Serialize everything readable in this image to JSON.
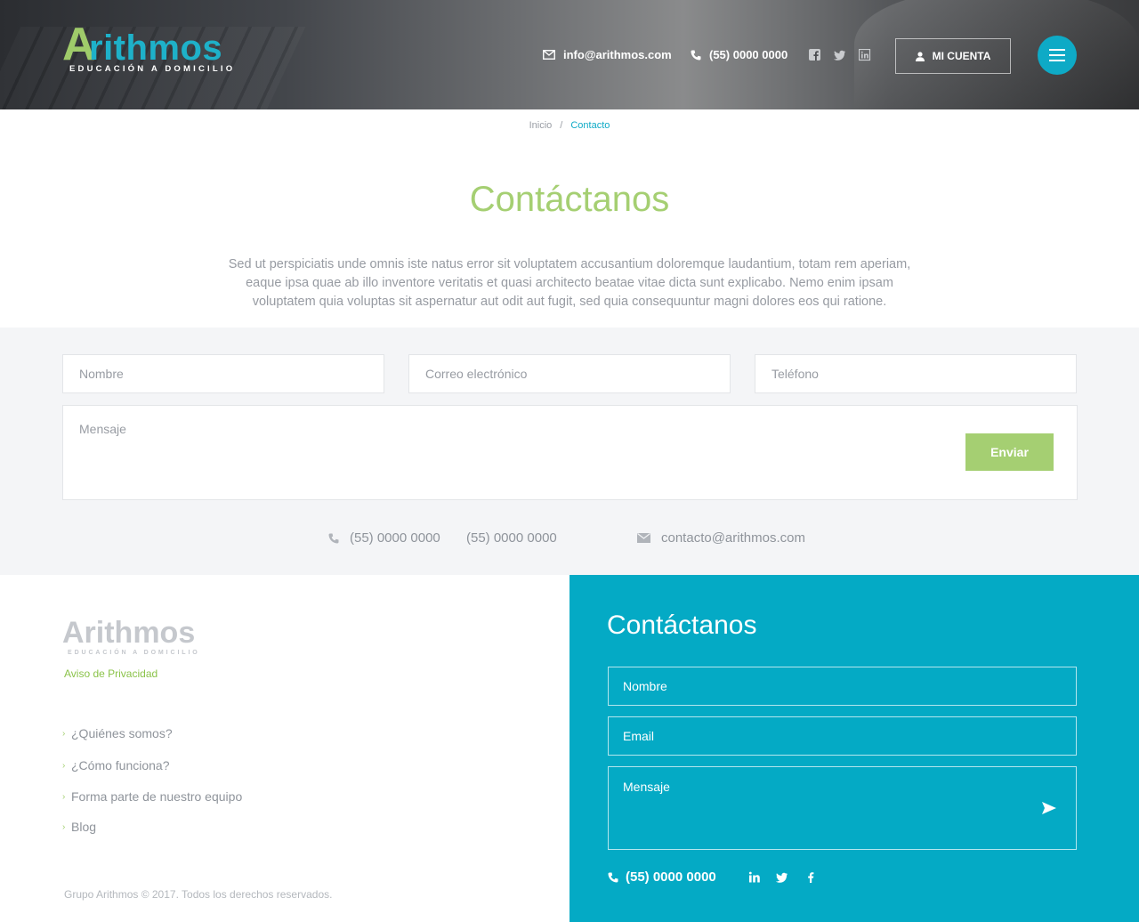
{
  "header": {
    "logo_letter": "A",
    "logo_rest": "rithmos",
    "logo_subtitle": "EDUCACIÓN A DOMICILIO",
    "email": "info@arithmos.com",
    "phone": "(55) 0000 0000",
    "account_label": "MI CUENTA",
    "social": [
      "facebook-icon",
      "twitter-icon",
      "linkedin-icon"
    ]
  },
  "breadcrumb": {
    "home": "Inicio",
    "separator": "/",
    "current": "Contacto"
  },
  "main": {
    "title": "Contáctanos",
    "intro": "Sed ut perspiciatis unde omnis iste natus error sit voluptatem accusantium doloremque laudantium, totam rem aperiam, eaque ipsa quae ab illo inventore veritatis et quasi architecto beatae vitae dicta sunt explicabo. Nemo enim ipsam voluptatem quia voluptas sit aspernatur aut odit aut fugit, sed quia consequuntur magni dolores eos qui ratione."
  },
  "form": {
    "name_placeholder": "Nombre",
    "email_placeholder": "Correo electrónico",
    "phone_placeholder": "Teléfono",
    "message_placeholder": "Mensaje",
    "send_label": "Enviar",
    "phone1": "(55) 0000 0000",
    "phone2": "(55) 0000 0000",
    "contact_email": "contacto@arithmos.com"
  },
  "footer": {
    "logo_text": "Arithmos",
    "logo_subtitle": "EDUCACIÓN A DOMICILIO",
    "privacy": "Aviso de Privacidad",
    "links": [
      "¿Quiénes somos?",
      "¿Cómo funciona?",
      "Forma parte de nuestro equipo",
      "Blog"
    ],
    "copyright": "Grupo Arithmos © 2017. Todos los derechos reservados.",
    "contact_title": "Contáctanos",
    "name_placeholder": "Nombre",
    "email_placeholder": "Email",
    "message_placeholder": "Mensaje",
    "phone": "(55) 0000 0000",
    "social": [
      "linkedin-icon",
      "twitter-icon",
      "facebook-icon"
    ]
  },
  "colors": {
    "accent_blue": "#04aac5",
    "accent_green": "#a5cf72",
    "form_bg": "#f4f5f7"
  }
}
